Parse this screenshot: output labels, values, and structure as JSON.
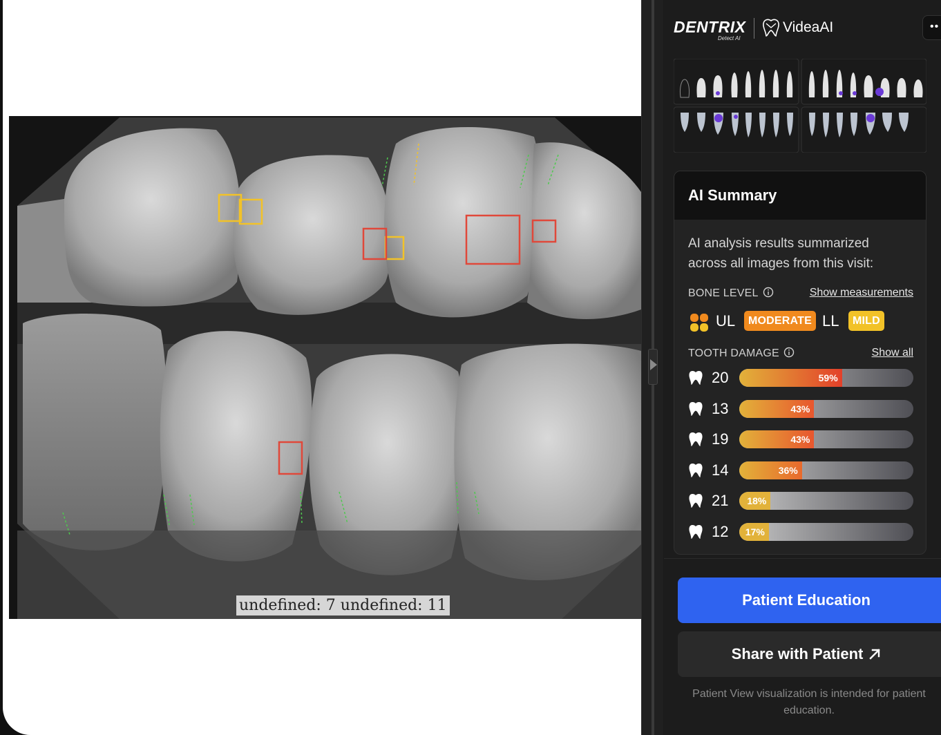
{
  "xray": {
    "caption": "undefined: 7 undefined: 11"
  },
  "brand": {
    "dentrix": "DENTRIX",
    "dentrix_sub": "Detect AI",
    "videa": "VideaAI"
  },
  "toolbar": {
    "more_label": "••"
  },
  "ai_summary": {
    "title": "AI Summary",
    "description": "AI analysis results summarized across all images from this visit:",
    "bone_level": {
      "label": "BONE LEVEL",
      "link": "Show measurements",
      "upper_jaw": "UL",
      "upper_severity": "MODERATE",
      "lower_jaw": "LL",
      "lower_severity": "MILD",
      "colors": {
        "moderate": "#f08a1e",
        "mild": "#f2c228"
      }
    },
    "tooth_damage": {
      "label": "TOOTH DAMAGE",
      "link": "Show all",
      "items": [
        {
          "tooth": "20",
          "percent": 59,
          "label": "59%"
        },
        {
          "tooth": "13",
          "percent": 43,
          "label": "43%"
        },
        {
          "tooth": "19",
          "percent": 43,
          "label": "43%"
        },
        {
          "tooth": "14",
          "percent": 36,
          "label": "36%"
        },
        {
          "tooth": "21",
          "percent": 18,
          "label": "18%"
        },
        {
          "tooth": "12",
          "percent": 17,
          "label": "17%"
        }
      ]
    }
  },
  "actions": {
    "patient_education": "Patient Education",
    "share_with_patient": "Share with Patient",
    "disclaimer": "Patient View visualization is intended for patient education."
  },
  "colors": {
    "accent_blue": "#2f63f0",
    "annotation_red": "#e0483a",
    "annotation_yellow": "#f2c228",
    "measurement_green": "#4ec94e"
  }
}
